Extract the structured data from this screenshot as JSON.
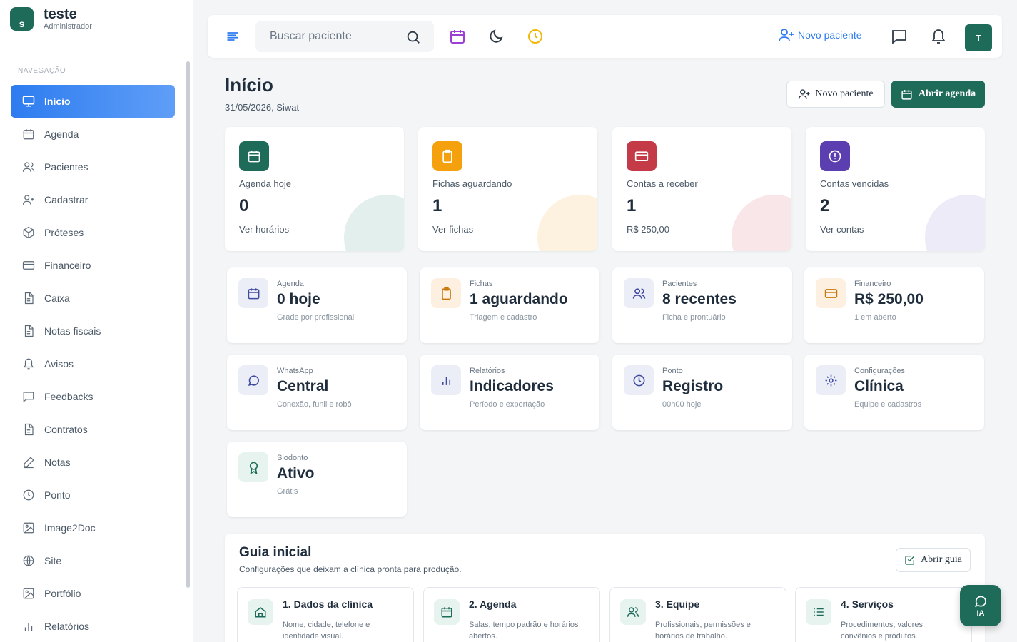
{
  "brand": {
    "name": "teste",
    "role": "Administrador",
    "logo_letter": "s"
  },
  "nav": {
    "caption": "NAVEGAÇÃO",
    "items": [
      {
        "label": "Início",
        "icon": "monitor-icon",
        "active": true
      },
      {
        "label": "Agenda",
        "icon": "calendar-icon"
      },
      {
        "label": "Pacientes",
        "icon": "users-icon"
      },
      {
        "label": "Cadastrar",
        "icon": "user-plus-icon"
      },
      {
        "label": "Próteses",
        "icon": "box-icon"
      },
      {
        "label": "Financeiro",
        "icon": "credit-card-icon"
      },
      {
        "label": "Caixa",
        "icon": "document-icon"
      },
      {
        "label": "Notas fiscais",
        "icon": "document-icon"
      },
      {
        "label": "Avisos",
        "icon": "bell-icon"
      },
      {
        "label": "Feedbacks",
        "icon": "message-icon"
      },
      {
        "label": "Contratos",
        "icon": "document-icon"
      },
      {
        "label": "Notas",
        "icon": "pen-icon"
      },
      {
        "label": "Ponto",
        "icon": "clock-icon"
      },
      {
        "label": "Image2Doc",
        "icon": "image-icon"
      },
      {
        "label": "Site",
        "icon": "globe-icon"
      },
      {
        "label": "Portfólio",
        "icon": "image-icon"
      },
      {
        "label": "Relatórios",
        "icon": "bar-chart-icon"
      }
    ]
  },
  "topbar": {
    "search_placeholder": "Buscar paciente",
    "new_patient": "Novo paciente",
    "avatar_letter": "T"
  },
  "header": {
    "title": "Início",
    "date": "31/05/2026, Siwat",
    "btn_new_patient": "Novo paciente",
    "btn_open_agenda": "Abrir agenda"
  },
  "stats": [
    {
      "label": "Agenda hoje",
      "value": "0",
      "sub": "Ver horários",
      "color": "#1f6b5a",
      "blob": "#e3efec"
    },
    {
      "label": "Fichas aguardando",
      "value": "1",
      "sub": "Ver fichas",
      "color": "#f5a00d",
      "blob": "#fdf1e0"
    },
    {
      "label": "Contas a receber",
      "value": "1",
      "sub": "R$ 250,00",
      "color": "#c53a47",
      "blob": "#f8e6e8"
    },
    {
      "label": "Contas vencidas",
      "value": "2",
      "sub": "Ver contas",
      "color": "#5b3fb0",
      "blob": "#ecebf7"
    }
  ],
  "modules": [
    {
      "caption": "Agenda",
      "title": "0 hoje",
      "desc": "Grade por profissional",
      "icon": "calendar-icon",
      "bg": "#eceef7",
      "fg": "#3e4aa0"
    },
    {
      "caption": "Fichas",
      "title": "1 aguardando",
      "desc": "Triagem e cadastro",
      "icon": "clipboard-icon",
      "bg": "#fdf0e0",
      "fg": "#c7770a"
    },
    {
      "caption": "Pacientes",
      "title": "8 recentes",
      "desc": "Ficha e prontuário",
      "icon": "users-icon",
      "bg": "#eceef7",
      "fg": "#3e4aa0"
    },
    {
      "caption": "Financeiro",
      "title": "R$ 250,00",
      "desc": "1 em aberto",
      "icon": "credit-card-icon",
      "bg": "#fdf0e0",
      "fg": "#c7770a"
    },
    {
      "caption": "WhatsApp",
      "title": "Central",
      "desc": "Conexão, funil e robô",
      "icon": "message-circle-icon",
      "bg": "#eceef7",
      "fg": "#3e4aa0"
    },
    {
      "caption": "Relatórios",
      "title": "Indicadores",
      "desc": "Período e exportação",
      "icon": "bar-chart-icon",
      "bg": "#eceef7",
      "fg": "#3e4aa0"
    },
    {
      "caption": "Ponto",
      "title": "Registro",
      "desc": "00h00 hoje",
      "icon": "clock-icon",
      "bg": "#eceef7",
      "fg": "#3e4aa0"
    },
    {
      "caption": "Configurações",
      "title": "Clínica",
      "desc": "Equipe e cadastros",
      "icon": "gear-icon",
      "bg": "#eceef7",
      "fg": "#3e4aa0"
    },
    {
      "caption": "Siodonto",
      "title": "Ativo",
      "desc": "Grátis",
      "icon": "award-icon",
      "bg": "#e6f3ee",
      "fg": "#1f6b5a"
    }
  ],
  "guide": {
    "title": "Guia inicial",
    "subtitle": "Configurações que deixam a clínica pronta para produção.",
    "button": "Abrir guia",
    "steps": [
      {
        "title": "1. Dados da clínica",
        "desc": "Nome, cidade, telefone e identidade visual.",
        "icon": "home-icon"
      },
      {
        "title": "2. Agenda",
        "desc": "Salas, tempo padrão e horários abertos.",
        "icon": "calendar-icon"
      },
      {
        "title": "3. Equipe",
        "desc": "Profissionais, permissões e horários de trabalho.",
        "icon": "users-icon"
      },
      {
        "title": "4. Serviços",
        "desc": "Procedimentos, valores, convênios e produtos.",
        "icon": "list-icon"
      }
    ]
  },
  "ia_label": "IA"
}
